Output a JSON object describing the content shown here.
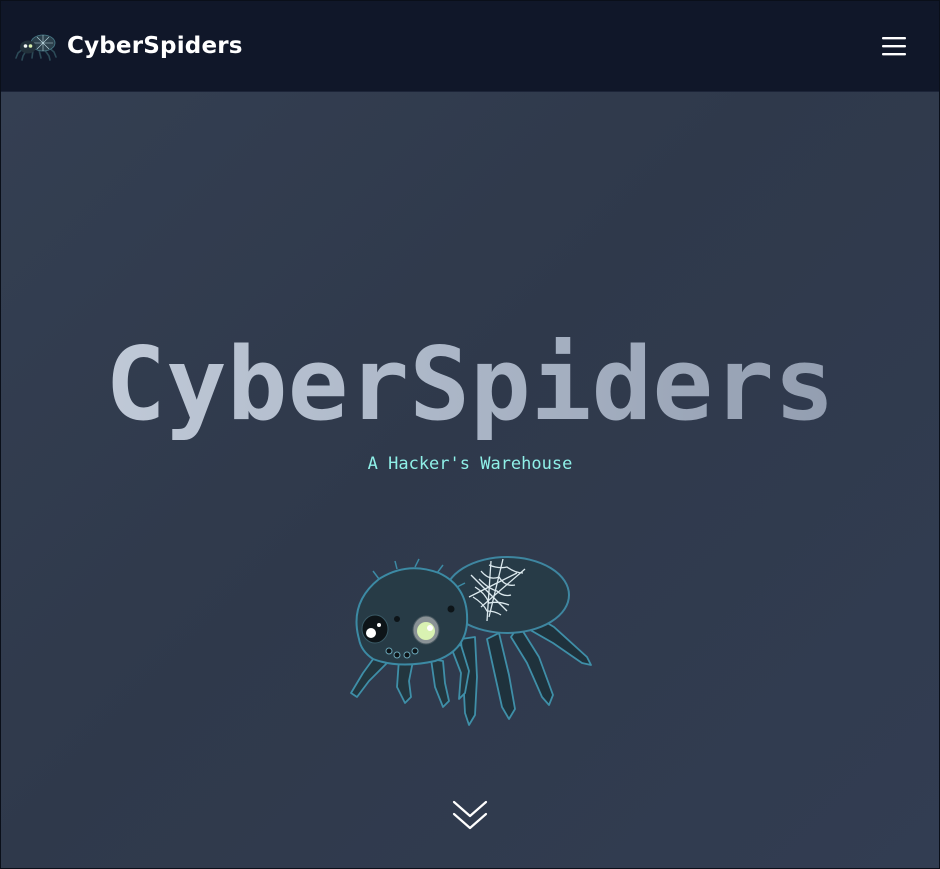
{
  "nav": {
    "brand_name": "CyberSpiders",
    "logo_icon": "spider-logo-icon",
    "menu_icon": "hamburger-menu-icon"
  },
  "hero": {
    "title": "CyberSpiders",
    "subtitle": "A Hacker's Warehouse",
    "mascot": "spider-mascot-illustration",
    "scroll_icon": "double-chevron-down-icon"
  },
  "colors": {
    "navbar_bg": "#101729",
    "hero_bg": "#323d50",
    "title_gradient_start": "#c6cfdc",
    "title_gradient_end": "#8c97aa",
    "subtitle": "#8ff0e8",
    "brand_text": "#ffffff"
  }
}
